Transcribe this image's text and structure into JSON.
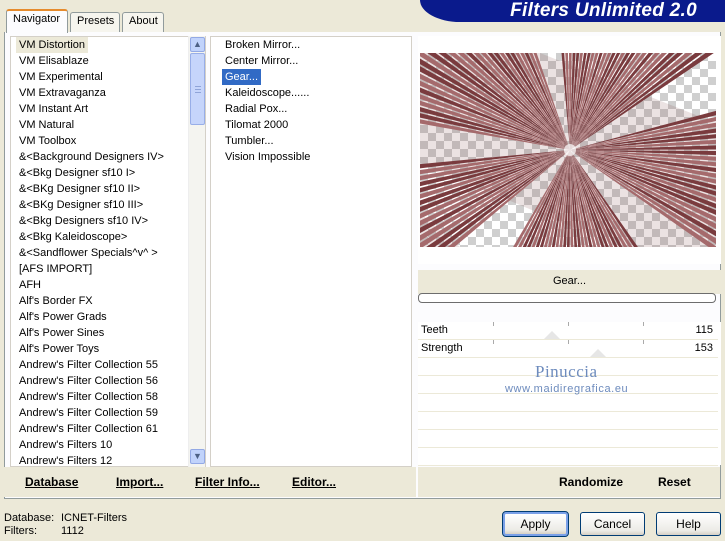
{
  "app": {
    "title": "Filters Unlimited 2.0"
  },
  "tabs": [
    {
      "label": "Navigator",
      "active": true
    },
    {
      "label": "Presets",
      "active": false
    },
    {
      "label": "About",
      "active": false
    }
  ],
  "categories": [
    "VM Distortion",
    "VM Elisablaze",
    "VM Experimental",
    "VM Extravaganza",
    "VM Instant Art",
    "VM Natural",
    "VM Toolbox",
    "&<Background Designers IV>",
    "&<Bkg Designer sf10 I>",
    "&<BKg Designer sf10 II>",
    "&<BKg Designer sf10 III>",
    "&<Bkg Designers sf10 IV>",
    "&<Bkg Kaleidoscope>",
    "&<Sandflower Specials^v^ >",
    "[AFS IMPORT]",
    "AFH",
    "Alf's Border FX",
    "Alf's Power Grads",
    "Alf's Power Sines",
    "Alf's Power Toys",
    "Andrew's Filter Collection 55",
    "Andrew's Filter Collection 56",
    "Andrew's Filter Collection 58",
    "Andrew's Filter Collection 59",
    "Andrew's Filter Collection 61",
    "Andrew's Filters 10",
    "Andrew's Filters 12"
  ],
  "selected_category": "VM Distortion",
  "filters": [
    "Broken Mirror...",
    "Center Mirror...",
    "Gear...",
    "Kaleidoscope......",
    "Radial Pox...",
    "Tilomat 2000",
    "Tumbler...",
    "Vision Impossible"
  ],
  "selected_filter": "Gear...",
  "preview": {
    "filter_name": "Gear...",
    "progress": 0
  },
  "params": [
    {
      "label": "Teeth",
      "value": "115"
    },
    {
      "label": "Strength",
      "value": "153"
    }
  ],
  "watermark": {
    "name": "Pinuccia",
    "site": "www.maidiregrafica.eu"
  },
  "actions": {
    "database": "Database",
    "import": "Import...",
    "filter_info": "Filter Info...",
    "editor": "Editor...",
    "randomize": "Randomize",
    "reset": "Reset"
  },
  "footer": {
    "database_label": "Database:",
    "database_value": "ICNET-Filters",
    "filters_label": "Filters:",
    "filters_value": "1112"
  },
  "buttons": {
    "apply": "Apply",
    "cancel": "Cancel",
    "help": "Help"
  },
  "colors": {
    "banner": "#0a1a8c",
    "selection": "#316ac5",
    "preview_tone": "#7a3b3e"
  }
}
